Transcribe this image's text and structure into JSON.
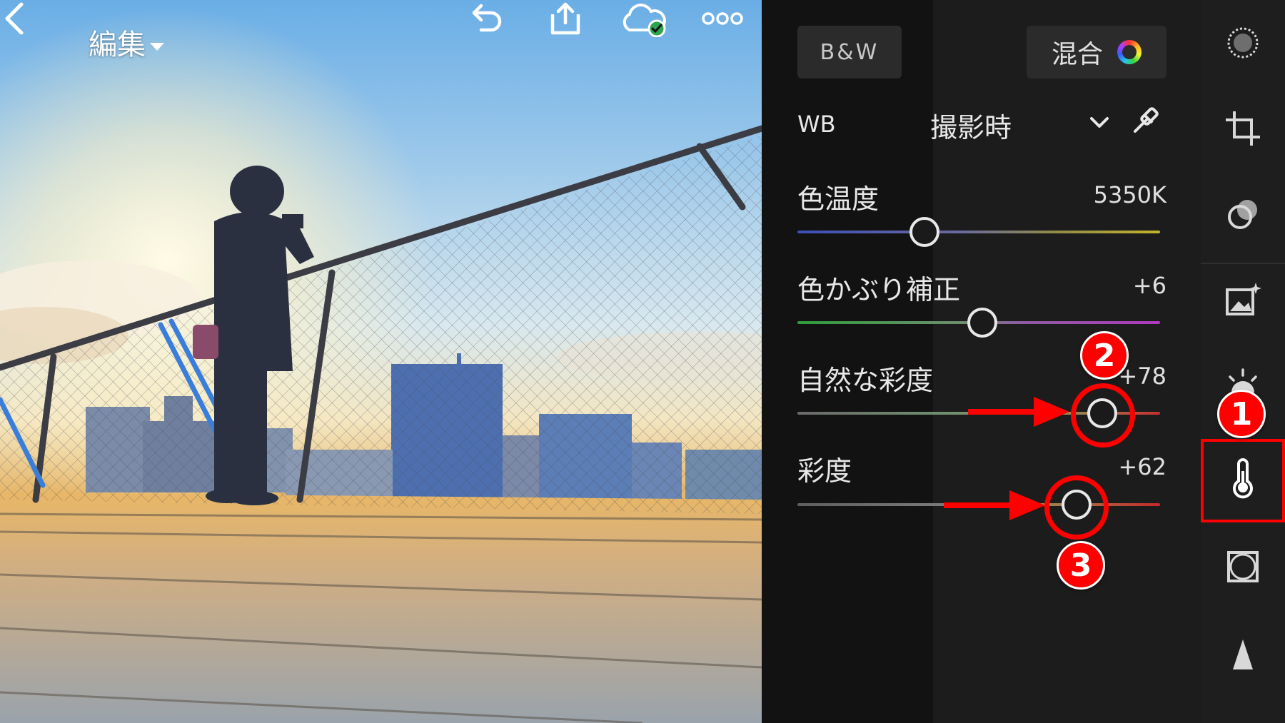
{
  "header": {
    "title": "編集",
    "icons": [
      "back-icon",
      "undo-icon",
      "share-icon",
      "cloud-synced-icon",
      "more-icon"
    ]
  },
  "profile_buttons": {
    "bw_label": "B&W",
    "mix_label": "混合"
  },
  "white_balance": {
    "label": "WB",
    "value": "撮影時"
  },
  "sliders": [
    {
      "label": "色温度",
      "value": "5350K",
      "position": 0.35
    },
    {
      "label": "色かぶり補正",
      "value": "+6",
      "position": 0.51
    },
    {
      "label": "自然な彩度",
      "value": "+78",
      "position": 0.84
    },
    {
      "label": "彩度",
      "value": "+62",
      "position": 0.77
    }
  ],
  "toolbar": {
    "icons": [
      "selective-icon",
      "crop-icon",
      "healing-icon",
      "presets-icon",
      "light-icon",
      "color-icon",
      "vignette-icon",
      "detail-icon"
    ],
    "active": "color-icon"
  },
  "annotations": {
    "badge_1": "1",
    "badge_2": "2",
    "badge_3": "3",
    "color": "#ff0000"
  }
}
